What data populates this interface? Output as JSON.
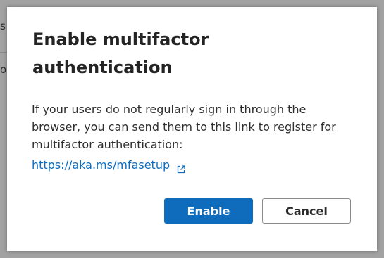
{
  "background": {
    "text_1": "s",
    "text_2": "o"
  },
  "dialog": {
    "title": "Enable multifactor authentication",
    "body": "If your users do not regularly sign in through the browser, you can send them to this link to register for multifactor authentication:",
    "link_text": "https://aka.ms/mfasetup",
    "link_icon": "open-in-new-window-icon",
    "enable_label": "Enable",
    "cancel_label": "Cancel"
  },
  "colors": {
    "accent": "#0f6cbd",
    "backdrop": "#a2a2a2",
    "dialog_bg": "#ffffff"
  }
}
